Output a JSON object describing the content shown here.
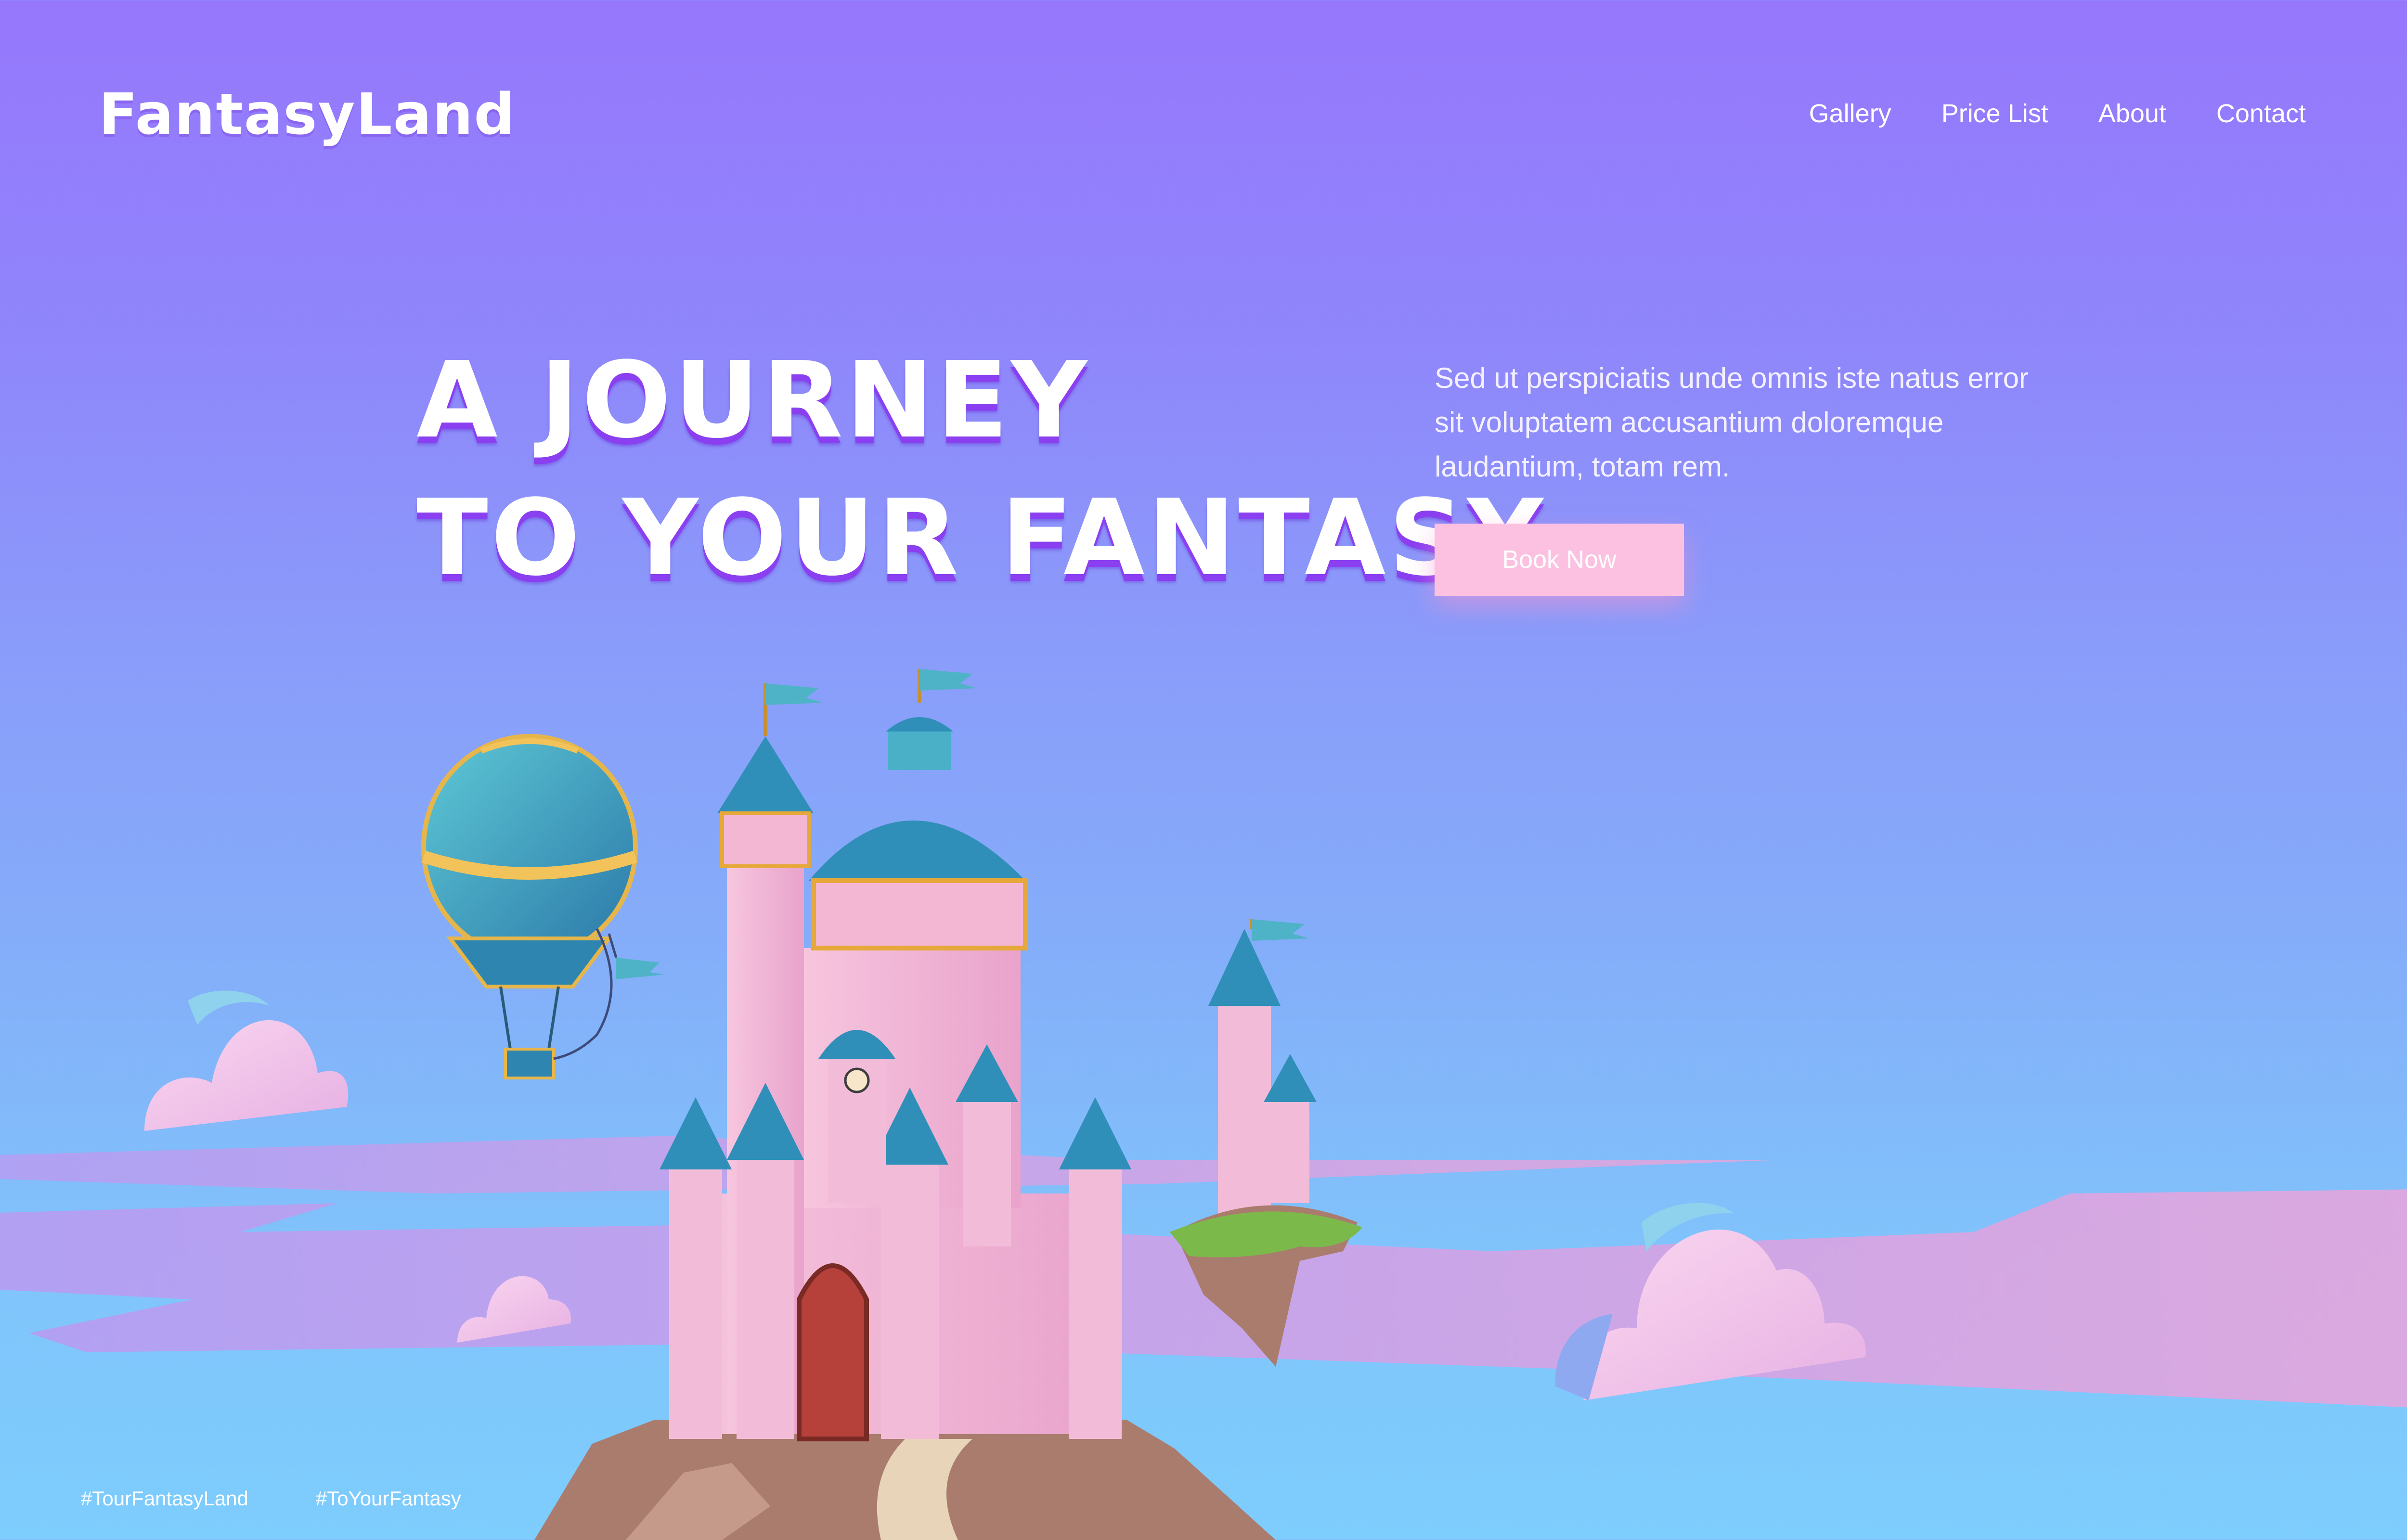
{
  "brand": {
    "name": "FantasyLand"
  },
  "nav": {
    "items": [
      "Gallery",
      "Price List",
      "About",
      "Contact"
    ]
  },
  "hero": {
    "headline_line1": "A JOURNEY",
    "headline_line2": "TO YOUR FANTASY",
    "description": "Sed ut perspiciatis unde omnis iste natus error sit voluptatem accusantium doloremque laudantium, totam rem.",
    "cta_label": "Book Now"
  },
  "footer": {
    "hashtags": [
      "#TourFantasyLand",
      "#ToYourFantasy"
    ]
  },
  "colors": {
    "accent": "#fcc1e0",
    "sky_top": "#9677fc",
    "sky_bottom": "#7dcdfd",
    "castle_pink": "#f4b3d4",
    "roof_teal": "#2f8fb8"
  },
  "icons": [
    "hot-air-balloon-icon",
    "castle-icon",
    "floating-island-icon",
    "cloud-icon"
  ]
}
